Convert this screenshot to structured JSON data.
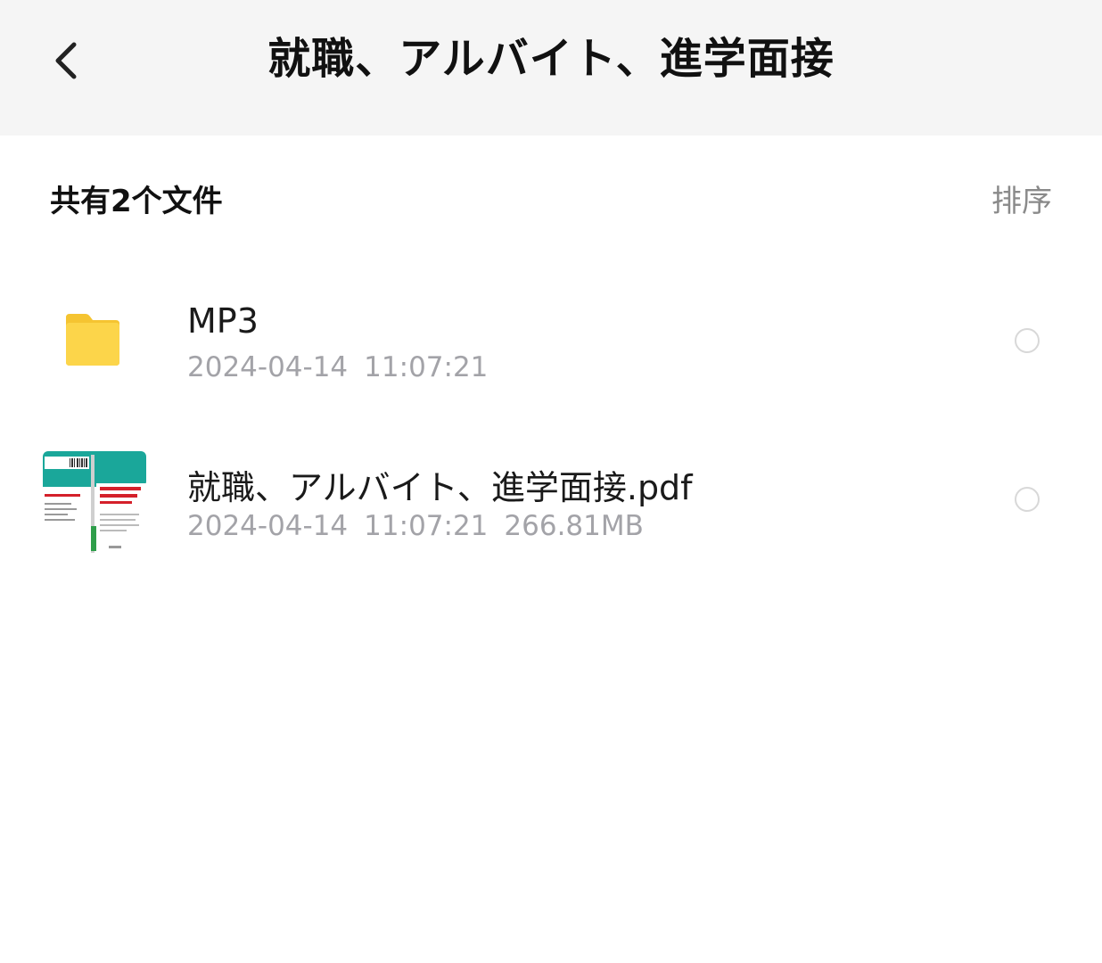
{
  "header": {
    "back_icon": "chevron-left-icon",
    "title": "就職、アルバイト、進学面接"
  },
  "summary": {
    "count_label": "共有2个文件",
    "sort_label": "排序"
  },
  "files": [
    {
      "name": "MP3",
      "date": "2024-04-14",
      "time": "11:07:21",
      "size": "",
      "icon": "folder-icon",
      "folder_color": "#f9cf3a"
    },
    {
      "name": "就職、アルバイト、進学面接.pdf",
      "date": "2024-04-14",
      "time": "11:07:21",
      "size": "266.81MB",
      "icon": "pdf-thumbnail",
      "thumb_accent": "#1aa79a"
    }
  ],
  "colors": {
    "header_bg": "#f5f5f5",
    "meta_text": "#a3a3a8",
    "sort_text": "#8a8a8a"
  }
}
